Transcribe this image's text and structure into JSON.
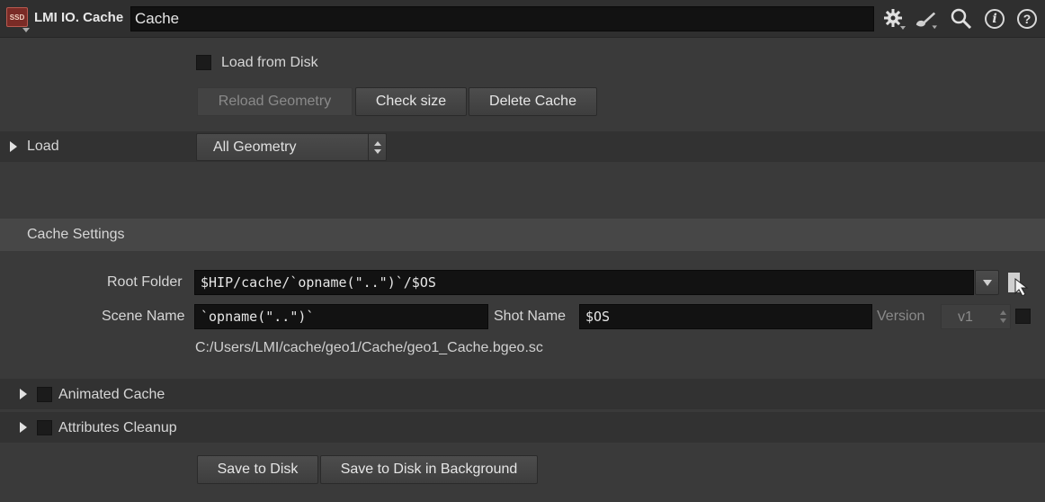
{
  "header": {
    "node_icon_text": "SSD",
    "node_type": "LMI IO. Cache",
    "node_name": "Cache",
    "icons": [
      "gear-icon",
      "paint-brush-icon",
      "search-icon",
      "info-icon",
      "help-icon"
    ],
    "info_glyph": "i",
    "help_glyph": "?"
  },
  "load_from_disk": {
    "label": "Load from Disk",
    "checked": false
  },
  "buttons_top": {
    "reload": "Reload Geometry",
    "check_size": "Check size",
    "delete_cache": "Delete Cache"
  },
  "load_folder": {
    "label": "Load",
    "select_value": "All Geometry"
  },
  "cache_settings": {
    "title": "Cache Settings",
    "root_folder_label": "Root Folder",
    "root_folder_value": "$HIP/cache/`opname(\"..\")`/$OS",
    "scene_name_label": "Scene Name",
    "scene_name_value": "`opname(\"..\")`",
    "shot_name_label": "Shot Name",
    "shot_name_value": "$OS",
    "version_label": "Version",
    "version_value": "v1",
    "output_path": "C:/Users/LMI/cache/geo1/Cache/geo1_Cache.bgeo.sc"
  },
  "folders": {
    "animated_cache": "Animated Cache",
    "attributes_cleanup": "Attributes Cleanup"
  },
  "buttons_bottom": {
    "save_to_disk": "Save to Disk",
    "save_bg": "Save to Disk in Background"
  },
  "colors": {
    "background": "#3a3a3a",
    "field": "#121212",
    "node_icon": "#7a2b26"
  }
}
